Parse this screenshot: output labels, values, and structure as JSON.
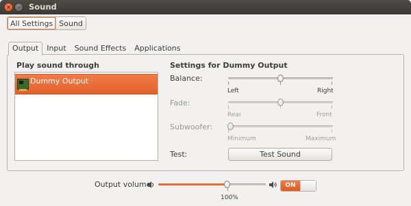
{
  "window": {
    "title": "Sound",
    "close_glyph": "×",
    "minimize_glyph": "–"
  },
  "breadcrumb": {
    "items": [
      "All Settings",
      "Sound"
    ]
  },
  "tabs": [
    "Output",
    "Input",
    "Sound Effects",
    "Applications"
  ],
  "active_tab": "Output",
  "output": {
    "list_title": "Play sound through",
    "devices": [
      {
        "label": "Dummy Output",
        "icon": "sound-card-icon",
        "selected": true
      }
    ],
    "settings_title": "Settings for Dummy Output",
    "balance": {
      "label": "Balance:",
      "left": "Left",
      "right": "Right",
      "value": 0.5
    },
    "fade": {
      "label": "Fade:",
      "left": "Rear",
      "right": "Front",
      "value": 0.5,
      "enabled": false
    },
    "subwoofer": {
      "label": "Subwoofer:",
      "left": "Minimum",
      "right": "Maximum",
      "value": 0.0,
      "enabled": false
    },
    "test": {
      "label": "Test:",
      "button": "Test Sound"
    }
  },
  "volume": {
    "label": "Output volume:",
    "value_text": "100%",
    "value": 0.65,
    "switch_label": "ON",
    "switch_on": true
  },
  "colors": {
    "accent": "#e3602a",
    "titlebar": "#3c3b37",
    "window_bg": "#f2f1f0"
  }
}
